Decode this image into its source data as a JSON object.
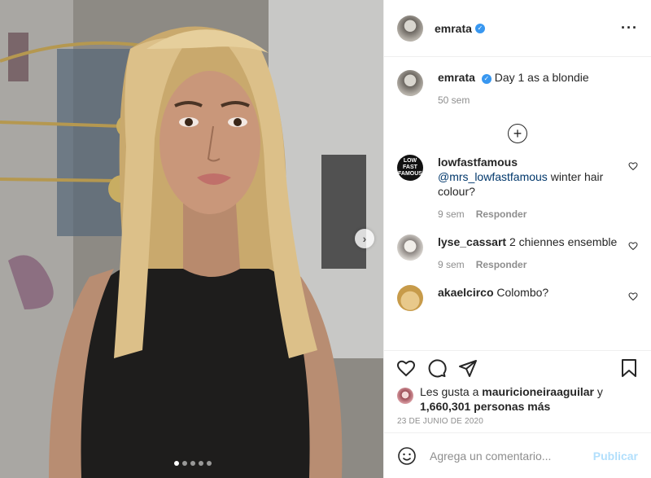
{
  "post": {
    "author": "emrata",
    "caption_author": "emrata",
    "caption": "Day 1 as a blondie",
    "caption_time": "50 sem",
    "likes_prefix": "Les gusta a",
    "likes_user": "mauricioneiraaguilar",
    "likes_joiner": "y",
    "likes_count": "1,660,301 personas más",
    "date": "23 DE JUNIO DE 2020",
    "carousel_total": 5,
    "carousel_index": 1
  },
  "comments": [
    {
      "user": "lowfastfamous",
      "avatar_text": [
        "LOW",
        "FAST",
        "FAMOUS"
      ],
      "mention": "@mrs_lowfastfamous",
      "text": "winter hair colour?",
      "time": "9 sem",
      "reply": "Responder"
    },
    {
      "user": "lyse_cassart",
      "mention": "",
      "text": "2 chiennes ensemble",
      "time": "9 sem",
      "reply": "Responder"
    },
    {
      "user": "akaelcirco",
      "mention": "",
      "text": "Colombo?",
      "time": "",
      "reply": ""
    }
  ],
  "more_comments_glyph": "+",
  "add_comment": {
    "placeholder": "Agrega un comentario...",
    "publish_label": "Publicar"
  },
  "icons": {
    "more": "more-options-icon",
    "verified": "verified-badge-icon",
    "like": "heart-icon",
    "comment": "comment-icon",
    "share": "share-icon",
    "save": "bookmark-icon",
    "emoji": "emoji-icon",
    "next": "chevron-right-icon"
  },
  "colors": {
    "verified": "#3897f0",
    "publish_disabled": "#b2dffc",
    "mention": "#00376b",
    "muted": "#8e8e8e"
  }
}
